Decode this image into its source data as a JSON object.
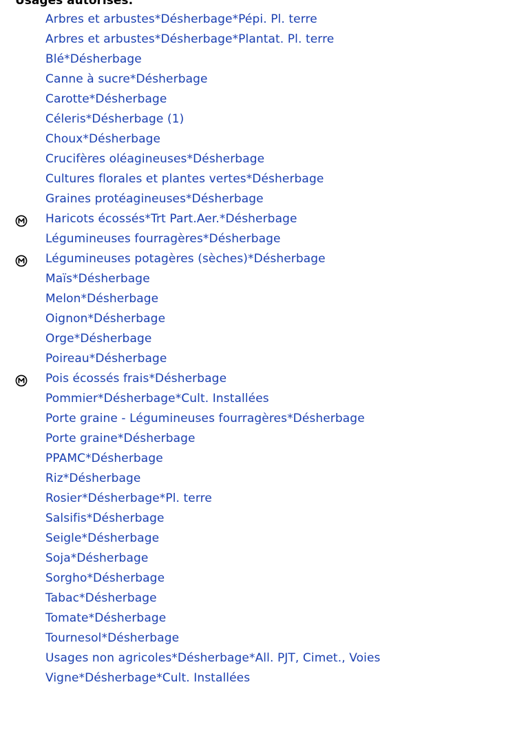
{
  "section": {
    "heading": "Usages autorisés:"
  },
  "usages": [
    {
      "label": "Arbres et arbustes*Désherbage*Pépi. Pl. terre",
      "mention": false
    },
    {
      "label": "Arbres et arbustes*Désherbage*Plantat. Pl. terre",
      "mention": false
    },
    {
      "label": "Blé*Désherbage",
      "mention": false
    },
    {
      "label": "Canne à sucre*Désherbage",
      "mention": false
    },
    {
      "label": "Carotte*Désherbage",
      "mention": false
    },
    {
      "label": "Céleris*Désherbage (1)",
      "mention": false
    },
    {
      "label": "Choux*Désherbage",
      "mention": false
    },
    {
      "label": "Crucifères oléagineuses*Désherbage",
      "mention": false
    },
    {
      "label": "Cultures florales et plantes vertes*Désherbage",
      "mention": false
    },
    {
      "label": "Graines protéagineuses*Désherbage",
      "mention": false
    },
    {
      "label": "Haricots écossés*Trt Part.Aer.*Désherbage",
      "mention": true
    },
    {
      "label": "Légumineuses fourragères*Désherbage",
      "mention": false
    },
    {
      "label": "Légumineuses potagères (sèches)*Désherbage",
      "mention": true
    },
    {
      "label": "Maïs*Désherbage",
      "mention": false
    },
    {
      "label": "Melon*Désherbage",
      "mention": false
    },
    {
      "label": "Oignon*Désherbage",
      "mention": false
    },
    {
      "label": "Orge*Désherbage",
      "mention": false
    },
    {
      "label": "Poireau*Désherbage",
      "mention": false
    },
    {
      "label": "Pois écossés frais*Désherbage",
      "mention": true
    },
    {
      "label": "Pommier*Désherbage*Cult. Installées",
      "mention": false
    },
    {
      "label": "Porte graine - Légumineuses fourragères*Désherbage",
      "mention": false
    },
    {
      "label": "Porte graine*Désherbage",
      "mention": false
    },
    {
      "label": "PPAMC*Désherbage",
      "mention": false
    },
    {
      "label": "Riz*Désherbage",
      "mention": false
    },
    {
      "label": "Rosier*Désherbage*Pl. terre",
      "mention": false
    },
    {
      "label": "Salsifis*Désherbage",
      "mention": false
    },
    {
      "label": "Seigle*Désherbage",
      "mention": false
    },
    {
      "label": "Soja*Désherbage",
      "mention": false
    },
    {
      "label": "Sorgho*Désherbage",
      "mention": false
    },
    {
      "label": "Tabac*Désherbage",
      "mention": false
    },
    {
      "label": "Tomate*Désherbage",
      "mention": false
    },
    {
      "label": "Tournesol*Désherbage",
      "mention": false
    },
    {
      "label": "Usages non agricoles*Désherbage*All. PJT, Cimet., Voies",
      "mention": false
    },
    {
      "label": "Vigne*Désherbage*Cult. Installées",
      "mention": false
    }
  ],
  "icons": {
    "mention": "circled-m-icon"
  },
  "colors": {
    "link": "#1a3fb0",
    "heading": "#000000"
  }
}
